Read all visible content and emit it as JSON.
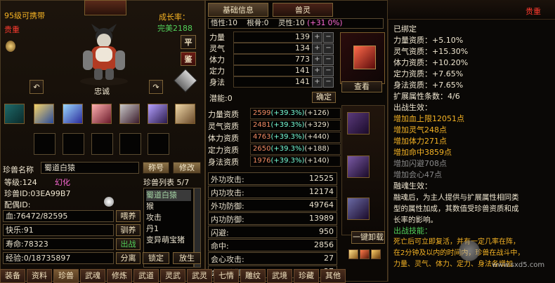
{
  "left": {
    "level_text": "95级可携带",
    "rarity": "贵重",
    "growth_label": "成长率：",
    "growth_value": "完美2188",
    "pet_name": "忠诚",
    "btn_ping": "平",
    "btn_jian": "鉴",
    "name_label": "珍兽名称",
    "name_value": "蜀道白猿",
    "btn_title": "称号",
    "btn_modify": "修改",
    "grade_label": "等级",
    "grade_value": ":124",
    "illusion": "幻化",
    "id_label": "珍兽ID:",
    "id_value": "03EA99B7",
    "spouse_label": "配偶ID:",
    "list_label": "珍兽列表 5/7",
    "list_items": [
      "蜀道白猿",
      "猴",
      "攻击",
      "丹1",
      "变异萌宝猪"
    ],
    "stats": [
      {
        "label": "血:",
        "value": "76472/82595",
        "btn": "喂养"
      },
      {
        "label": "快乐:",
        "value": "91",
        "btn": "驯养"
      },
      {
        "label": "寿命:",
        "value": "78323",
        "btn": "出战"
      },
      {
        "label": "经验:",
        "value": "0/18735897",
        "btn": "分离"
      }
    ],
    "btn_lock": "锁定",
    "btn_release": "放生"
  },
  "mid": {
    "tab_basic": "基础信息",
    "tab_soul": "兽灵",
    "row1": {
      "wuxing": "悟性:10",
      "gengu": "根骨:0",
      "lingxing": "灵性:10",
      "lingxing_bonus": "(+31 0%)"
    },
    "attrs": [
      {
        "label": "力量",
        "value": "139"
      },
      {
        "label": "灵气",
        "value": "134"
      },
      {
        "label": "体力",
        "value": "773"
      },
      {
        "label": "定力",
        "value": "141"
      },
      {
        "label": "身法",
        "value": "141"
      }
    ],
    "potential_label": "潜能:",
    "potential_value": "0",
    "confirm_btn": "确定",
    "quals": [
      {
        "label": "力量资质",
        "base": "2599",
        "pct": "(+39.3%)",
        "add": "(+126)"
      },
      {
        "label": "灵气资质",
        "base": "2481",
        "pct": "(+39.3%)",
        "add": "(+329)"
      },
      {
        "label": "体力资质",
        "base": "4763",
        "pct": "(+39.3%)",
        "add": "(+440)"
      },
      {
        "label": "定力资质",
        "base": "2650",
        "pct": "(+39.3%)",
        "add": "(+188)"
      },
      {
        "label": "身法资质",
        "base": "1976",
        "pct": "(+39.3%)",
        "add": "(+140)"
      }
    ],
    "lower": [
      {
        "label": "外功攻击:",
        "value": "12525"
      },
      {
        "label": "内功攻击:",
        "value": "12174"
      },
      {
        "label": "外功防御:",
        "value": "49764"
      },
      {
        "label": "内功防御:",
        "value": "13989"
      },
      {
        "label": "闪避:",
        "value": "950"
      },
      {
        "label": "命中:",
        "value": "2856"
      },
      {
        "label": "会心攻击:",
        "value": "27"
      },
      {
        "label": "会心防御:",
        "value": "27"
      }
    ],
    "view_btn": "查看",
    "oneclick_btn": "一键卸载"
  },
  "right": {
    "top_label": "贵重",
    "bound": "已绑定",
    "lines": [
      {
        "text": "力量资质：+5.10%"
      },
      {
        "text": "灵气资质：+15.30%"
      },
      {
        "text": "体力资质：+10.20%"
      },
      {
        "text": "定力资质：+7.65%"
      },
      {
        "text": "身法资质：+7.65%"
      },
      {
        "text": "扩展属性条数：4/6"
      },
      {
        "text": "出战生效："
      }
    ],
    "effects": [
      {
        "text": "增加血上限12051点",
        "color": "gold"
      },
      {
        "text": "增加灵气248点",
        "color": "gold"
      },
      {
        "text": "增加体力271点",
        "color": "gold"
      },
      {
        "text": "增加命中3859点",
        "color": "gold"
      },
      {
        "text": "增加闪避708点",
        "color": "muted"
      },
      {
        "text": "增加会心47点",
        "color": "muted"
      }
    ],
    "fusion_title": "融魂生效：",
    "fusion_text1": "融魂后，为主人提供与扩展属性相同类",
    "fusion_text2": "型的属性加成，其数值受珍兽资质和成",
    "fusion_text3": "长率的影响。",
    "skill_title": "出战技能：",
    "skill_text1": "死亡后可立即复活，并有一定几率在阵，",
    "skill_text2": "在2分钟及以内的时间内，珍兽在战斗中，",
    "skill_text3": "力量、灵气、体力、定力、身法各增加",
    "watermark": "www.sxd5.com"
  },
  "bottom_tabs": [
    "装备",
    "资料",
    "珍兽",
    "武魂",
    "修炼",
    "武道",
    "灵武",
    "武灵",
    "七情",
    "雕纹",
    "武境",
    "珍藏",
    "其他"
  ]
}
